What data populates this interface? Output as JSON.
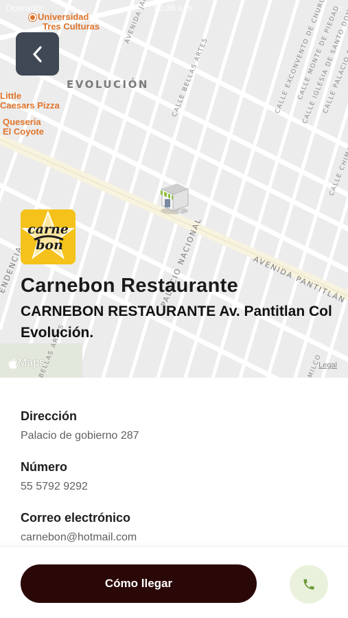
{
  "status_bar": {
    "carrier": "Operador",
    "time": "10:36 a.m."
  },
  "map": {
    "district": "EVOLUCIÓN",
    "streets": [
      "AVENIDA PANTITLÁN",
      "PALACIO NACIONAL",
      "CALLE BELLAS ARTES",
      "AVENIDA JARDÍN",
      "CALLE EXCONVENTO DE CHURUBUSCO",
      "CALLE MONTE DE PIEDAD",
      "CALLE IGLESIA DE SANTO DOMINGO",
      "CALLE PALACIO DE MINERÍA",
      "CALLE CHIMALPOPOCA",
      "ENDENCIA",
      "BELLAS ARTES",
      "MILCO"
    ],
    "pois": [
      {
        "name_line1": "Universidad",
        "name_line2": "Tres Culturas"
      },
      {
        "name_line1": "Little",
        "name_line2": "Caesars Pizza"
      },
      {
        "name_line1": "Queseria",
        "name_line2": "El Coyote"
      }
    ],
    "attribution": "Maps",
    "legal": "Legal",
    "back_icon": "chevron-left-icon",
    "marker_icon": "store-awning-icon"
  },
  "place": {
    "logo_text_line1": "carne",
    "logo_text_line2": "bon",
    "name": "Carnebon Restaurante",
    "description": "CARNEBON RESTAURANTE Av. Pantitlan Col Evolución."
  },
  "details": {
    "address_label": "Dirección",
    "address_value": "Palacio de gobierno 287",
    "phone_label": "Número",
    "phone_value": "55 5792 9292",
    "email_label": "Correo electrónico",
    "email_value": "carnebon@hotmail.com"
  },
  "actions": {
    "directions_label": "Cómo llegar",
    "call_icon": "phone-icon"
  },
  "colors": {
    "primary_button": "#2b0808",
    "call_button_bg": "#e9f1dc",
    "call_icon": "#6d9a3a",
    "back_button": "#3f4854",
    "poi": "#e0742a",
    "logo_bg": "#f4c21a"
  }
}
